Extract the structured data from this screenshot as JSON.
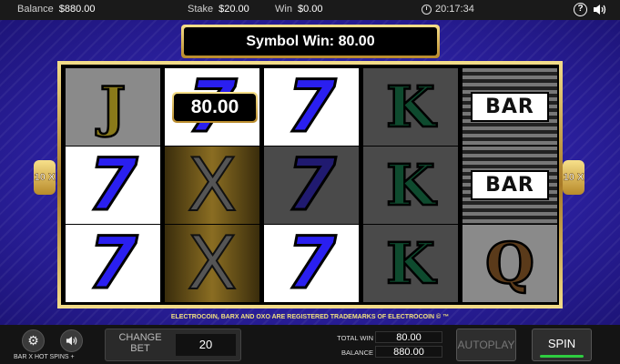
{
  "topbar": {
    "balance_label": "Balance",
    "balance_value": "$880.00",
    "stake_label": "Stake",
    "stake_value": "$20.00",
    "win_label": "Win",
    "win_value": "$0.00",
    "clock": "20:17:34",
    "help_icon": "?",
    "sound_icon": "speaker-icon"
  },
  "banner": {
    "symbol_win": "Symbol Win: 80.00"
  },
  "win_label": "80.00",
  "line_markers": {
    "left": "10 X",
    "right": "10 X"
  },
  "reels": [
    [
      "J",
      "7",
      "7"
    ],
    [
      "7",
      "X",
      "X"
    ],
    [
      "7",
      "7",
      "7"
    ],
    [
      "K",
      "K",
      "K"
    ],
    [
      "BAR",
      "BAR",
      "Q"
    ]
  ],
  "trademark": "ELECTROCOIN, BARX AND OXO ARE REGISTERED TRADEMARKS OF ELECTROCOIN © ™",
  "bottom": {
    "settings_icon": "gear-icon",
    "volume_icon": "speaker-icon",
    "game_name": "BAR X HOT SPINS +",
    "change_bet_label": "CHANGE BET",
    "bet_value": "20",
    "total_win_label": "TOTAL WIN",
    "total_win_value": "80.00",
    "balance_label": "BALANCE",
    "balance_value": "880.00",
    "autoplay_label": "AUTOPLAY",
    "spin_label": "SPIN"
  },
  "colors": {
    "background_blue": "#2a1f9c",
    "gold": "#d8b24a",
    "seven_blue": "#2a1ff0",
    "spin_indicator": "#2ecc40"
  }
}
